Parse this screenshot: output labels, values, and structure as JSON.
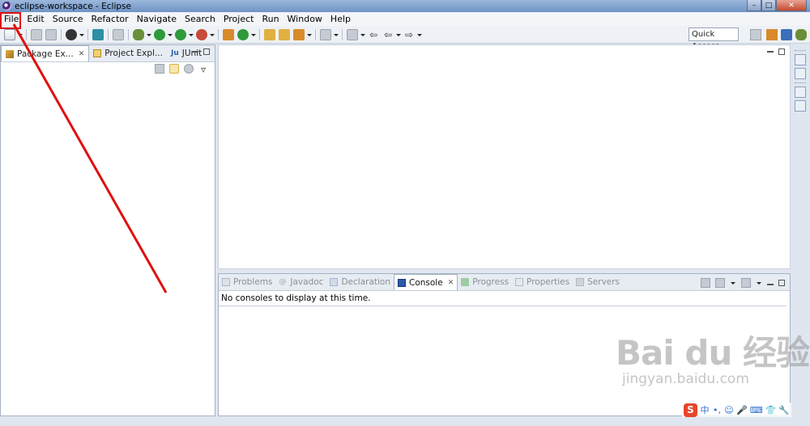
{
  "window": {
    "title": "eclipse-workspace - Eclipse",
    "controls": [
      "–",
      "□",
      "✕"
    ]
  },
  "menu": {
    "items": [
      "File",
      "Edit",
      "Source",
      "Refactor",
      "Navigate",
      "Search",
      "Project",
      "Run",
      "Window",
      "Help"
    ]
  },
  "toolbar": {
    "quick_access": "Quick Access"
  },
  "left_panel": {
    "tabs": [
      {
        "label": "Package Ex...",
        "active": true
      },
      {
        "label": "Project Expl...",
        "active": false
      },
      {
        "label": "JUnit",
        "active": false
      }
    ],
    "junit_prefix": "Ju"
  },
  "bottom_panel": {
    "tabs": [
      {
        "label": "Problems",
        "active": false
      },
      {
        "label": "Javadoc",
        "active": false
      },
      {
        "label": "Declaration",
        "active": false
      },
      {
        "label": "Console",
        "active": true
      },
      {
        "label": "Progress",
        "active": false
      },
      {
        "label": "Properties",
        "active": false
      },
      {
        "label": "Servers",
        "active": false
      }
    ],
    "javadoc_glyph": "@",
    "console_message": "No consoles to display at this time."
  },
  "watermark": {
    "logo": "Bai du 经验",
    "url": "jingyan.baidu.com"
  },
  "ime": {
    "logo": "S",
    "items": [
      "中",
      "•,",
      "☺",
      "🎤",
      "⌨",
      "👕",
      "🔧"
    ]
  },
  "colors": {
    "annotation": "#e01010",
    "title_bar": "#7a9bc9",
    "panel_border": "#a7b3c4"
  }
}
